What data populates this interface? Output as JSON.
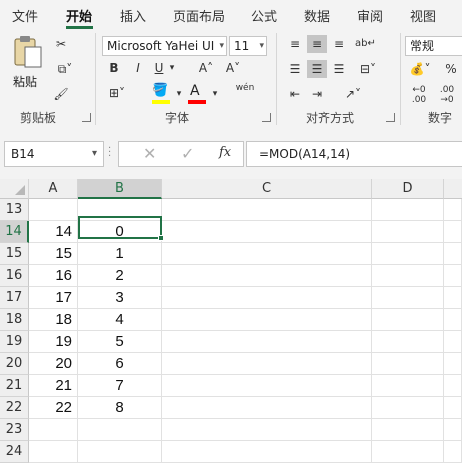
{
  "ribbon_tabs": [
    {
      "label": "文件",
      "active": false
    },
    {
      "label": "开始",
      "active": true
    },
    {
      "label": "插入",
      "active": false
    },
    {
      "label": "页面布局",
      "active": false
    },
    {
      "label": "公式",
      "active": false
    },
    {
      "label": "数据",
      "active": false
    },
    {
      "label": "审阅",
      "active": false
    },
    {
      "label": "视图",
      "active": false
    }
  ],
  "clipboard": {
    "paste_label": "粘贴",
    "group_label": "剪贴板"
  },
  "font": {
    "font_name": "Microsoft YaHei UI",
    "font_size": "11",
    "bold": "B",
    "italic": "I",
    "underline": "U",
    "grow": "A˄",
    "shrink": "A˅",
    "phonetic": "wén",
    "group_label": "字体"
  },
  "alignment": {
    "group_label": "对齐方式"
  },
  "number": {
    "format": "常规",
    "group_label": "数字"
  },
  "formula_bar": {
    "name_box": "B14",
    "fx": "fx",
    "formula": "=MOD(A14,14)"
  },
  "columns": [
    "A",
    "B",
    "C",
    "D"
  ],
  "rows": [
    {
      "num": "13",
      "a": "",
      "b": ""
    },
    {
      "num": "14",
      "a": "14",
      "b": "0"
    },
    {
      "num": "15",
      "a": "15",
      "b": "1"
    },
    {
      "num": "16",
      "a": "16",
      "b": "2"
    },
    {
      "num": "17",
      "a": "17",
      "b": "3"
    },
    {
      "num": "18",
      "a": "18",
      "b": "4"
    },
    {
      "num": "19",
      "a": "19",
      "b": "5"
    },
    {
      "num": "20",
      "a": "20",
      "b": "6"
    },
    {
      "num": "21",
      "a": "21",
      "b": "7"
    },
    {
      "num": "22",
      "a": "22",
      "b": "8"
    },
    {
      "num": "23",
      "a": "",
      "b": ""
    },
    {
      "num": "24",
      "a": "",
      "b": ""
    }
  ],
  "selected": {
    "column": "B",
    "row": "14"
  },
  "colors": {
    "accent": "#217346",
    "ribbon_bg": "#f3f3f3",
    "highlight_yellow": "#ffff00",
    "font_color_red": "#ff0000"
  }
}
